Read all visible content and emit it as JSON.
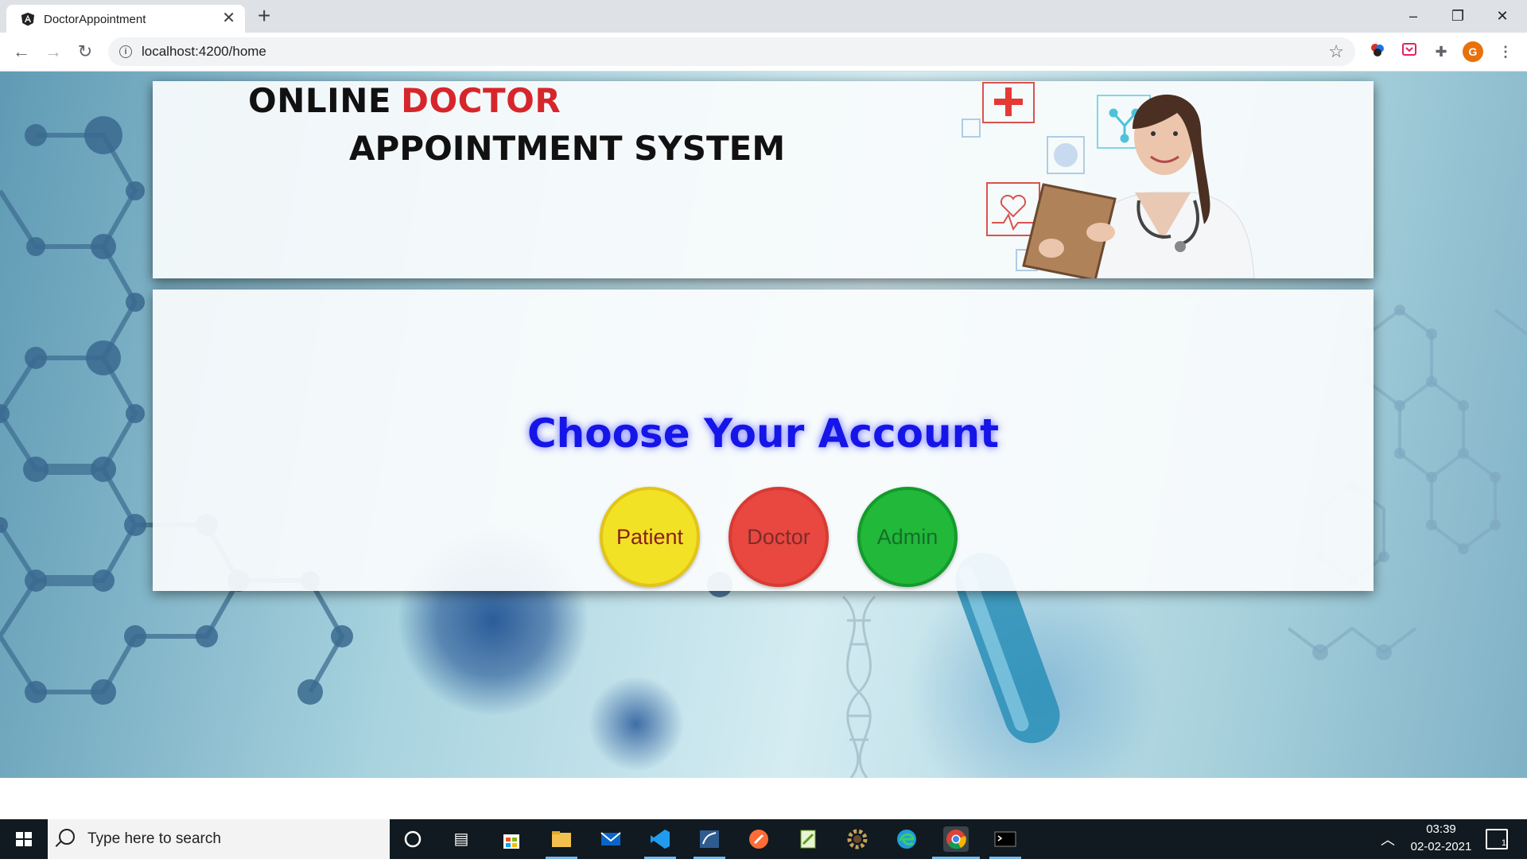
{
  "browser": {
    "tab_title": "DoctorAppointment",
    "url": "localhost:4200/home",
    "profile_initial": "G"
  },
  "header": {
    "title_part1": "ONLINE",
    "title_accent": "DOCTOR",
    "title_part2": "APPOINTMENT SYSTEM"
  },
  "main": {
    "heading": "Choose Your Account",
    "buttons": {
      "patient": "Patient",
      "doctor": "Doctor",
      "admin": "Admin"
    }
  },
  "colors": {
    "heading": "#1515e8",
    "title_accent": "#d7262b",
    "patient": "#f2e225",
    "doctor": "#e8483f",
    "admin": "#22b83a"
  },
  "taskbar": {
    "search_placeholder": "Type here to search",
    "time": "03:39",
    "date": "02-02-2021",
    "notification_count": "1",
    "apps": [
      "cortana-icon",
      "task-view-icon",
      "store-icon",
      "file-explorer-icon",
      "mail-icon",
      "vscode-icon",
      "sql-icon",
      "postman-icon",
      "notepad-icon",
      "settings-icon",
      "edge-icon",
      "chrome-icon",
      "terminal-icon"
    ]
  }
}
